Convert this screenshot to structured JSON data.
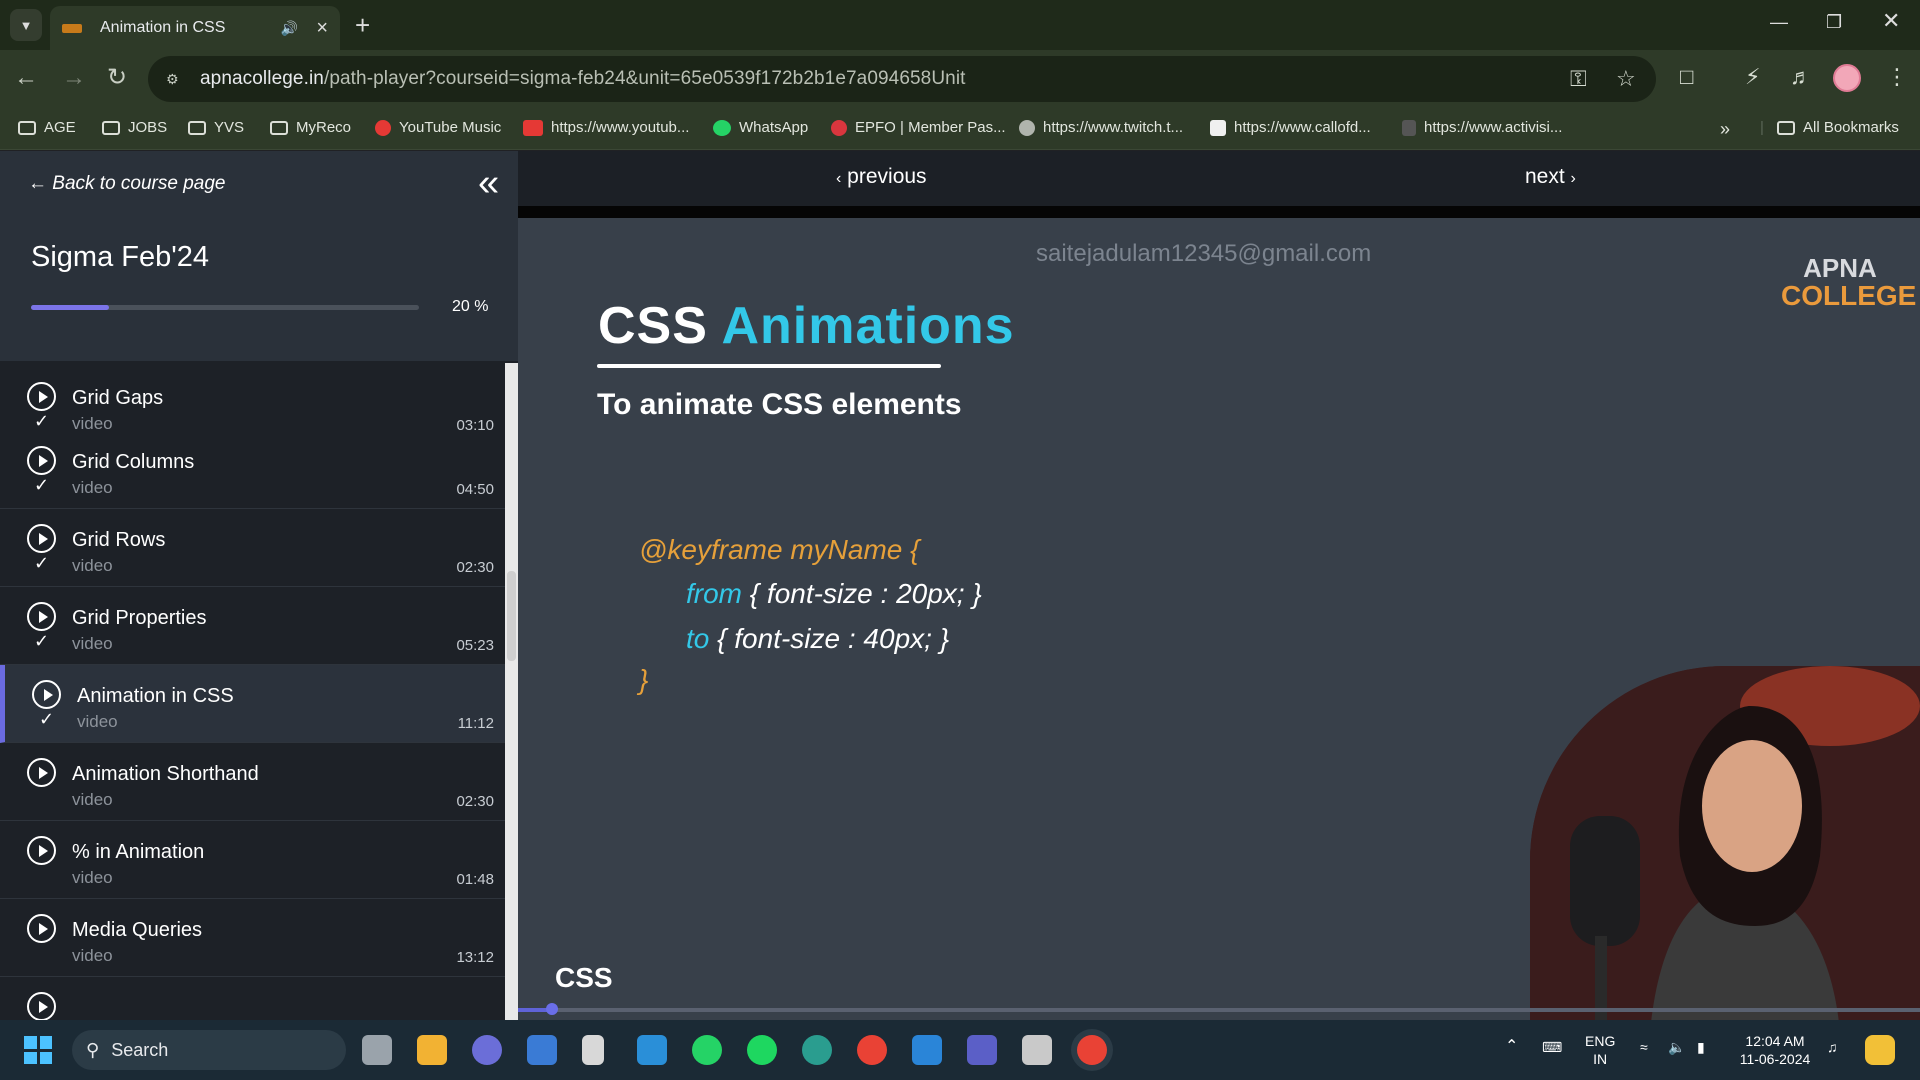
{
  "browser": {
    "tab_title": "Animation in CSS",
    "url_host": "apnacollege.in",
    "url_path": "/path-player?courseid=sigma-feb24&unit=65e0539f172b2b1e7a094658Unit"
  },
  "bookmarks": [
    "AGE",
    "JOBS",
    "YVS",
    "MyReco",
    "YouTube Music",
    "https://www.youtub...",
    "WhatsApp",
    "EPFO | Member Pas...",
    "https://www.twitch.t...",
    "https://www.callofd...",
    "https://www.activisi...",
    "All Bookmarks"
  ],
  "sidebar": {
    "back_label": "← Back to course page",
    "course_title": "Sigma Feb'24",
    "progress_label": "20 %",
    "progress": 0.2
  },
  "lessons": [
    {
      "name": "Grid Gaps",
      "type": "video",
      "duration": "03:10",
      "done": true
    },
    {
      "name": "Grid Columns",
      "type": "video",
      "duration": "04:50",
      "done": true
    },
    {
      "name": "Grid Rows",
      "type": "video",
      "duration": "02:30",
      "done": true
    },
    {
      "name": "Grid Properties",
      "type": "video",
      "duration": "05:23",
      "done": true
    },
    {
      "name": "Animation in CSS",
      "type": "video",
      "duration": "11:12",
      "done": true
    },
    {
      "name": "Animation Shorthand",
      "type": "video",
      "duration": "02:30",
      "done": false
    },
    {
      "name": "% in Animation",
      "type": "video",
      "duration": "01:48",
      "done": false
    },
    {
      "name": "Media Queries",
      "type": "video",
      "duration": "13:12",
      "done": false
    }
  ],
  "player": {
    "previous": "previous",
    "next": "next",
    "watermark": "saitejadulam12345@gmail.com",
    "logo_line1": "APNA",
    "logo_line2": "COLLEGE"
  },
  "slide": {
    "title_part1": "CSS",
    "title_part2": "Animations",
    "subtitle": "To animate CSS elements",
    "code_line1": "@keyframe myName {",
    "code_from": "from",
    "code_line2_rest": "{ font-size : 20px; }",
    "code_to": "to",
    "code_line3_rest": "{ font-size : 40px; }",
    "code_close": "}",
    "corner_label": "CSS",
    "video_progress": 0.024
  },
  "taskbar": {
    "search": "Search",
    "lang1": "ENG",
    "lang2": "IN",
    "time": "12:04 AM",
    "date": "11-06-2024"
  }
}
